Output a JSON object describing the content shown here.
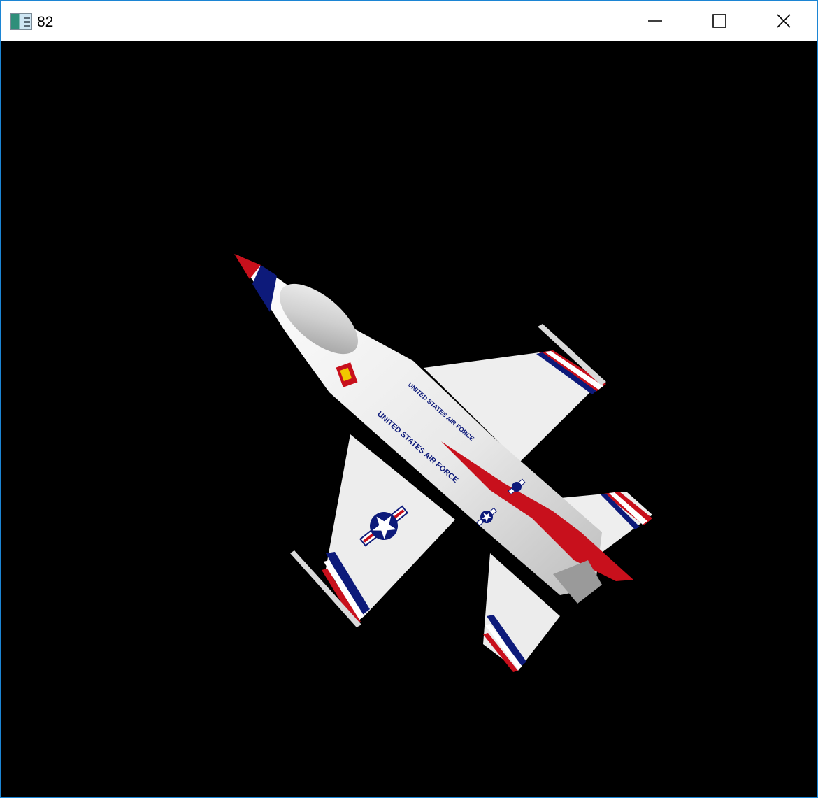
{
  "window": {
    "title": "82",
    "icon": "app-window-icon",
    "controls": {
      "minimize": "minimize-icon",
      "maximize": "maximize-icon",
      "close": "close-icon"
    },
    "border_color": "#1c85d4"
  },
  "viewport": {
    "background": "#000000",
    "scene": {
      "subject": "jet-fighter",
      "livery_colors": {
        "white": "#f2f2f2",
        "red": "#c8101c",
        "blue": "#0d1a7a"
      },
      "fuselage_text_1": "UNITED STATES AIR FORCE",
      "fuselage_text_2": "UNITED STATES AIR FORCE"
    }
  }
}
